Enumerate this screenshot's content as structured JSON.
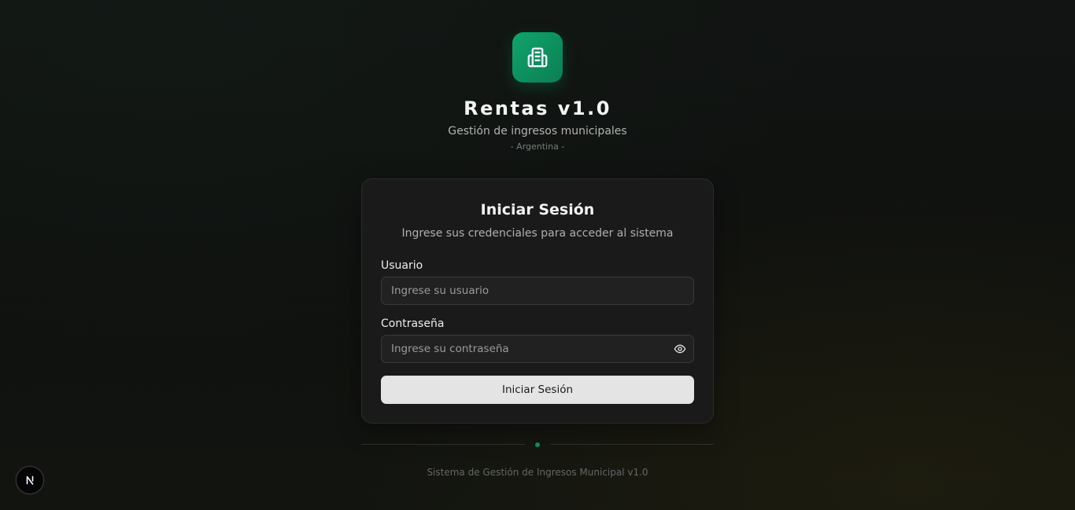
{
  "header": {
    "title": "Rentas v1.0",
    "subtitle": "Gestión de ingresos municipales",
    "country": "- Argentina -"
  },
  "login": {
    "title": "Iniciar Sesión",
    "description": "Ingrese sus credenciales para acceder al sistema",
    "username_label": "Usuario",
    "username_placeholder": "Ingrese su usuario",
    "username_value": "",
    "password_label": "Contraseña",
    "password_placeholder": "Ingrese su contraseña",
    "password_value": "",
    "submit_label": "Iniciar Sesión"
  },
  "footer": {
    "text": "Sistema de Gestión de Ingresos Municipal v1.0"
  },
  "icons": {
    "logo": "building-icon",
    "password_toggle": "eye-icon",
    "dev_badge": "nextjs-icon"
  },
  "colors": {
    "brand": "#0f9a65",
    "background": "#101210",
    "card": "#1a1a1a",
    "button": "#e4e4e4"
  }
}
